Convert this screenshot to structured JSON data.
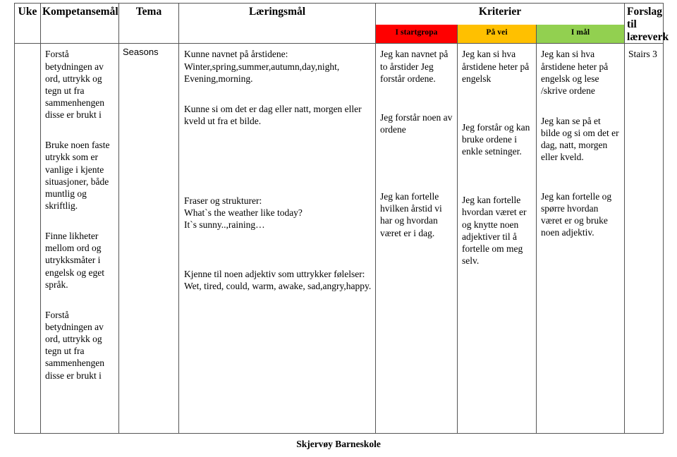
{
  "document": {
    "footer": "Skjervøy Barneskole"
  },
  "table": {
    "headers": {
      "uke": "Uke",
      "kompetansemal": "Kompetansemål",
      "tema": "Tema",
      "laringsmal": "Læringsmål",
      "kriterier": "Kriterier",
      "forslag_line1": "Forslag",
      "forslag_line2": "til",
      "forslag_line3": "læreverk"
    },
    "criteria_levels": [
      {
        "label": "I startgropa",
        "color": "#ff0000"
      },
      {
        "label": "På vei",
        "color": "#ffc000"
      },
      {
        "label": "I mål",
        "color": "#92d050"
      }
    ],
    "row": {
      "uke": "",
      "kompetansemal": [
        "Forstå betydningen av ord, uttrykk og tegn ut fra sammenhengen disse er brukt i",
        "Bruke noen faste utrykk som er vanlige i kjente situasjoner, både muntlig og skriftlig.",
        "Finne likheter mellom ord og utrykksmåter i engelsk og eget språk.",
        "Forstå betydningen av ord, uttrykk og tegn ut fra sammenhengen disse er brukt i"
      ],
      "tema": "Seasons",
      "laringsmal": [
        "Kunne navnet på årstidene: Winter,spring,summer,autumn,day,night, Evening,morning.",
        "Kunne si om det er dag eller natt, morgen eller kveld ut fra et bilde.",
        "Fraser og strukturer:\nWhat`s the weather like today?\nIt`s sunny..,raining…",
        "Kjenne til noen adjektiv som uttrykker følelser:\nWet, tired, could, warm, awake, sad,angry,happy."
      ],
      "i_startgropa": [
        "Jeg kan navnet på to årstider Jeg forstår ordene.",
        "Jeg forstår noen av ordene",
        "Jeg kan fortelle hvilken årstid vi har og hvordan været er i dag."
      ],
      "pa_vei": [
        "Jeg kan si hva årstidene heter på engelsk",
        "Jeg forstår og kan bruke ordene i enkle setninger.",
        "Jeg kan fortelle hvordan været er og knytte noen adjektiver til å fortelle om meg selv."
      ],
      "i_mal": [
        "Jeg kan si hva årstidene heter på engelsk og lese /skrive ordene",
        "Jeg kan se på et bilde og si om det er dag, natt, morgen eller kveld.",
        "Jeg kan fortelle og spørre hvordan været er og bruke noen adjektiv."
      ],
      "forslag_til_laereverk": "Stairs 3"
    }
  }
}
